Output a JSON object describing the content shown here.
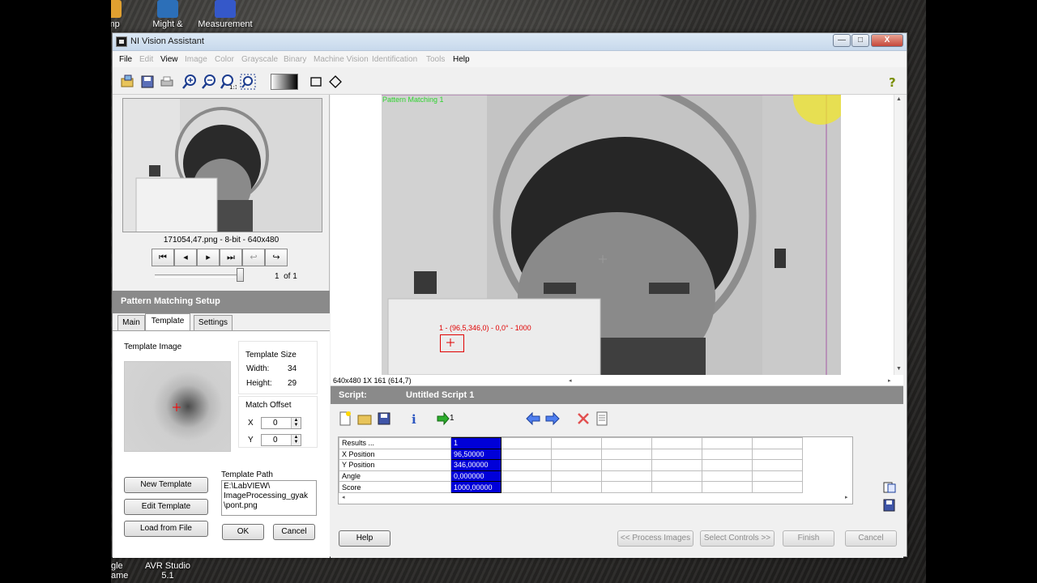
{
  "desktop": {
    "icons": [
      {
        "label": "emp"
      },
      {
        "label": "Might &"
      },
      {
        "label": "Measurement"
      },
      {
        "label": "gle"
      },
      {
        "label": "AVR Studio"
      },
      {
        "label": "ame"
      },
      {
        "label": "5.1"
      }
    ]
  },
  "window": {
    "title": "NI Vision Assistant",
    "controls": {
      "minimize": "—",
      "maximize": "□",
      "close": "X"
    }
  },
  "menu": {
    "items": [
      {
        "label": "File",
        "enabled": true
      },
      {
        "label": "Edit",
        "enabled": false
      },
      {
        "label": "View",
        "enabled": true
      },
      {
        "label": "Image",
        "enabled": false
      },
      {
        "label": "Color",
        "enabled": false
      },
      {
        "label": "Grayscale",
        "enabled": false
      },
      {
        "label": "Binary",
        "enabled": false
      },
      {
        "label": "Machine Vision",
        "enabled": false
      },
      {
        "label": "Identification",
        "enabled": false
      },
      {
        "label": "Tools",
        "enabled": false
      },
      {
        "label": "Help",
        "enabled": true
      }
    ]
  },
  "browser": {
    "caption": "171054,47.png - 8-bit - 640x480",
    "frame_index": "1",
    "frame_of": "of",
    "frame_total": "1"
  },
  "setup": {
    "header": "Pattern Matching Setup",
    "tabs": [
      "Main",
      "Template",
      "Settings"
    ],
    "active_tab": "Template",
    "template_image_label": "Template Image",
    "template_size_label": "Template Size",
    "width_label": "Width:",
    "width_value": "34",
    "height_label": "Height:",
    "height_value": "29",
    "match_offset_label": "Match Offset",
    "x_label": "X",
    "x_value": "0",
    "y_label": "Y",
    "y_value": "0",
    "template_path_label": "Template Path",
    "template_path_lines": [
      "E:\\LabVIEW\\",
      "ImageProcessing_gyak",
      "\\pont.png"
    ],
    "new_template": "New Template",
    "edit_template": "Edit Template",
    "load_from_file": "Load from File",
    "ok": "OK",
    "cancel": "Cancel"
  },
  "image_view": {
    "overlay_title": "Pattern Matching 1",
    "match_label": "1 - (96,5,346,0) - 0,0° - 1000",
    "status": "640x480 1X 161   (614,7)"
  },
  "script": {
    "label": "Script:",
    "name": "Untitled Script 1",
    "run_once_label": "1"
  },
  "results": {
    "rows": [
      {
        "name": "Results ...",
        "value": "1"
      },
      {
        "name": "X Position",
        "value": "96,50000"
      },
      {
        "name": "Y Position",
        "value": "346,00000"
      },
      {
        "name": "Angle",
        "value": "0,000000"
      },
      {
        "name": "Score",
        "value": "1000,00000"
      }
    ]
  },
  "bottom": {
    "help": "Help",
    "process_images": "<< Process Images",
    "select_controls": "Select Controls >>",
    "finish": "Finish",
    "cancel": "Cancel"
  },
  "colors": {
    "accent_blue": "#0000d8",
    "overlay_green": "#2fd32f",
    "match_red": "#e00000",
    "header_gray": "#8a8a8a"
  }
}
